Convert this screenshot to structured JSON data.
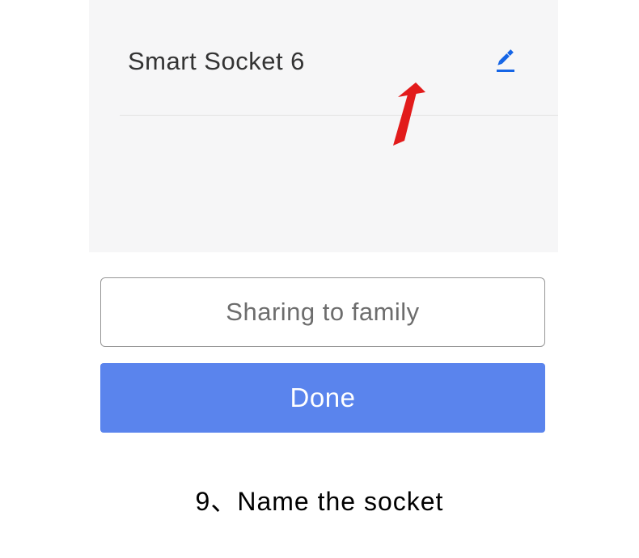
{
  "device": {
    "name": "Smart Socket 6"
  },
  "buttons": {
    "share_label": "Sharing to family",
    "done_label": "Done"
  },
  "caption": {
    "text": "9、Name the socket"
  },
  "icons": {
    "edit": "edit-pencil",
    "arrow": "arrow-pointer"
  },
  "colors": {
    "accent": "#1565e6",
    "primary_button": "#5a84ed",
    "arrow": "#e21b1b"
  }
}
